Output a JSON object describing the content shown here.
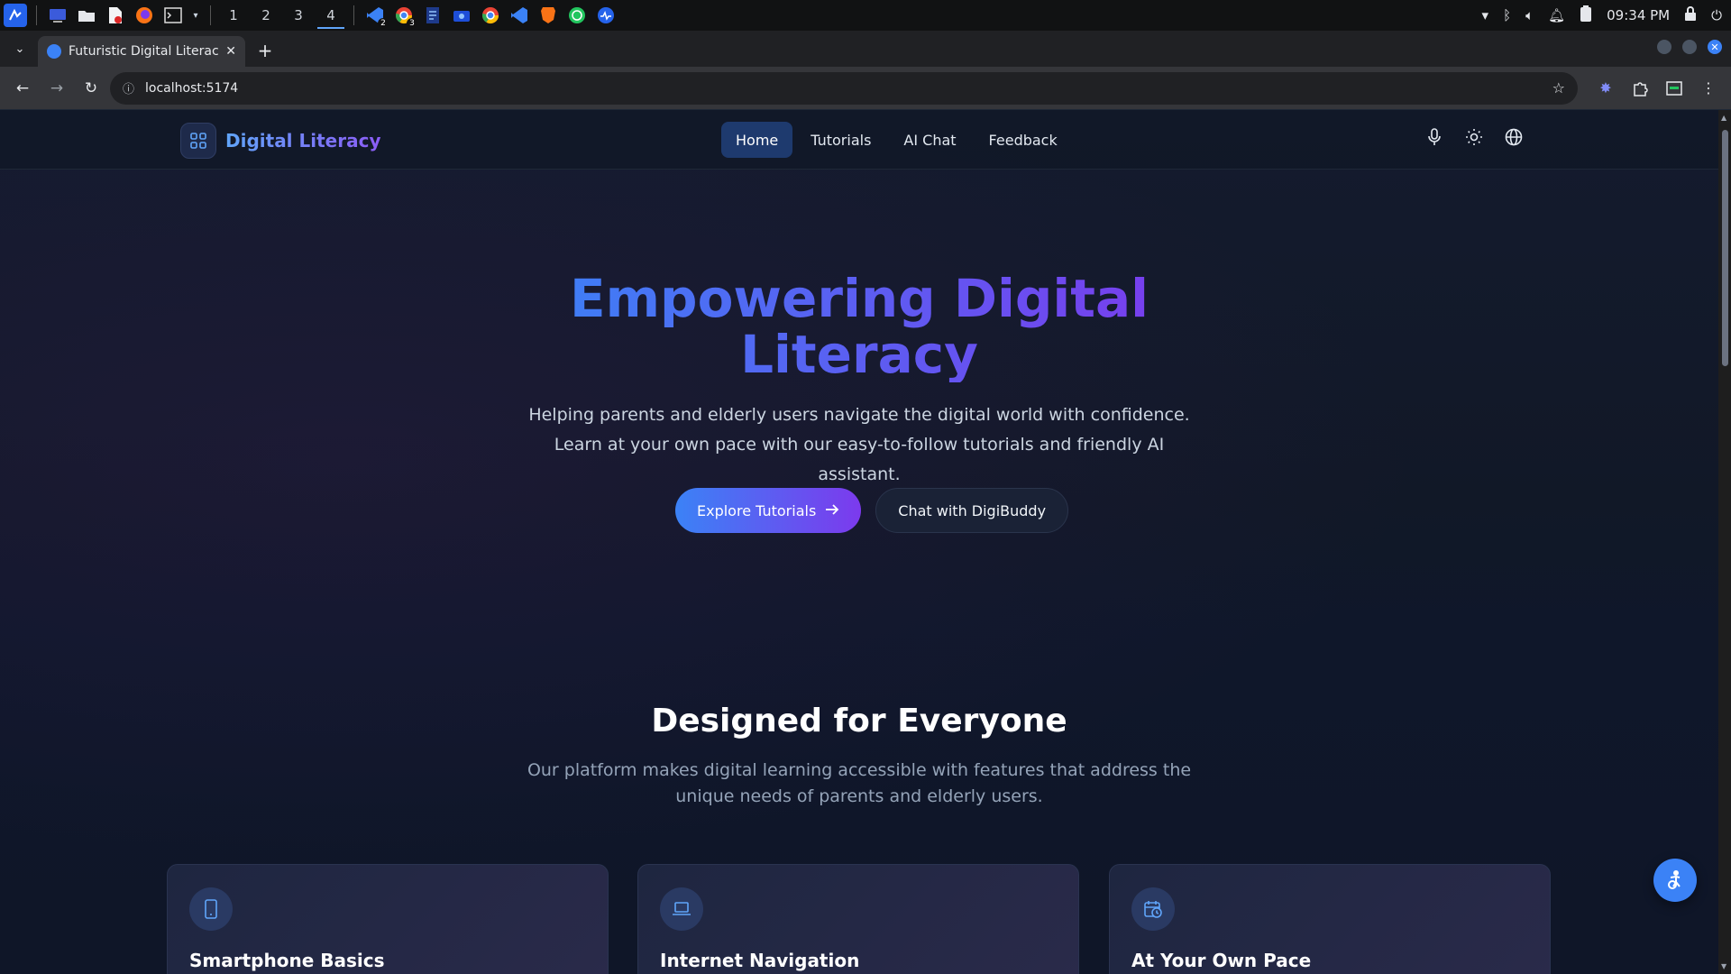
{
  "taskbar": {
    "workspaces": [
      "1",
      "2",
      "3",
      "4"
    ],
    "active_workspace": "4",
    "vscode_badge": "2",
    "chrome_badge": "3",
    "clock": "09:34 PM"
  },
  "browser": {
    "tab_title": "Futuristic Digital Literacy",
    "url": "localhost:5174"
  },
  "site": {
    "brand": "Digital Literacy",
    "nav": [
      "Home",
      "Tutorials",
      "AI Chat",
      "Feedback"
    ],
    "active_nav": "Home"
  },
  "hero": {
    "title_line1": "Empowering Digital",
    "title_line2": "Literacy",
    "subtitle": "Helping parents and elderly users navigate the digital world with confidence. Learn at your own pace with our easy-to-follow tutorials and friendly AI assistant.",
    "primary_cta": "Explore Tutorials",
    "secondary_cta": "Chat with DigiBuddy"
  },
  "features": {
    "title": "Designed for Everyone",
    "subtitle": "Our platform makes digital learning accessible with features that address the unique needs of parents and elderly users.",
    "cards": [
      {
        "title": "Smartphone Basics",
        "icon": "smartphone-icon"
      },
      {
        "title": "Internet Navigation",
        "icon": "laptop-icon"
      },
      {
        "title": "At Your Own Pace",
        "icon": "calendar-clock-icon"
      }
    ]
  },
  "colors": {
    "accent_blue": "#3b82f6",
    "accent_purple": "#7c3aed",
    "background": "#0f172a"
  }
}
